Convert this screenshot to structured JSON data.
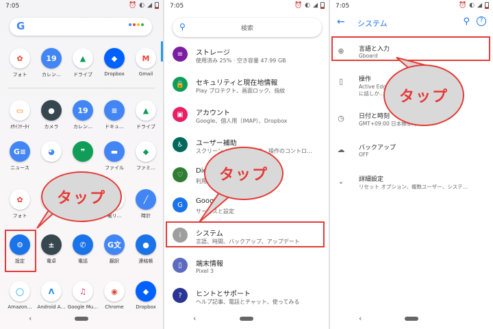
{
  "status": {
    "time": "7:05"
  },
  "home": {
    "google_letter": "G",
    "apps": [
      {
        "label": "フォト",
        "color": "#ffffff",
        "glyph": "✿",
        "fg": "#ea4335"
      },
      {
        "label": "カレン…",
        "color": "#4285f4",
        "glyph": "19",
        "fg": "#fff"
      },
      {
        "label": "ドライブ",
        "color": "#ffffff",
        "glyph": "▲",
        "fg": "#0f9d58"
      },
      {
        "label": "Dropbox",
        "color": "#0061ff",
        "glyph": "◆",
        "fg": "#fff"
      },
      {
        "label": "Gmail",
        "color": "#ffffff",
        "glyph": "M",
        "fg": "#ea4335"
      },
      {
        "label": "ｵｻｲﾌｹｰﾀｲ",
        "color": "#ffffff",
        "glyph": "▭",
        "fg": "#f57c00"
      },
      {
        "label": "カメラ",
        "color": "#37474f",
        "glyph": "●",
        "fg": "#fff"
      },
      {
        "label": "カレン…",
        "color": "#4285f4",
        "glyph": "19",
        "fg": "#fff"
      },
      {
        "label": "ドキュ…",
        "color": "#4285f4",
        "glyph": "≡",
        "fg": "#fff"
      },
      {
        "label": "ドライブ",
        "color": "#ffffff",
        "glyph": "▲",
        "fg": "#0f9d58"
      },
      {
        "label": "ニュース",
        "color": "#4285f4",
        "glyph": "G≡",
        "fg": "#fff"
      },
      {
        "label": "",
        "color": "#ffffff",
        "glyph": "◕",
        "fg": "#4285f4"
      },
      {
        "label": "",
        "color": "#0f9d58",
        "glyph": "❞",
        "fg": "#fff"
      },
      {
        "label": "ファイル",
        "color": "#4285f4",
        "glyph": "▬",
        "fg": "#fff"
      },
      {
        "label": "ファミ…",
        "color": "#ffffff",
        "glyph": "◆",
        "fg": "#0f9d58"
      },
      {
        "label": "フォト",
        "color": "#ffffff",
        "glyph": "✿",
        "fg": "#ea4335"
      },
      {
        "label": "",
        "color": "#ffffff",
        "glyph": "",
        "fg": "#fff"
      },
      {
        "label": "",
        "color": "#ffffff",
        "glyph": "",
        "fg": "#fff"
      },
      {
        "label": "電リ…",
        "color": "#ffffff",
        "glyph": "",
        "fg": "#fff"
      },
      {
        "label": "時計",
        "color": "#4285f4",
        "glyph": "╱",
        "fg": "#fff"
      },
      {
        "label": "設定",
        "color": "#1a73e8",
        "glyph": "⚙",
        "fg": "#fff"
      },
      {
        "label": "電卓",
        "color": "#37474f",
        "glyph": "±",
        "fg": "#fff"
      },
      {
        "label": "電話",
        "color": "#1a73e8",
        "glyph": "✆",
        "fg": "#fff"
      },
      {
        "label": "翻訳",
        "color": "#4285f4",
        "glyph": "G文",
        "fg": "#fff"
      },
      {
        "label": "連絡帳",
        "color": "#1a73e8",
        "glyph": "●",
        "fg": "#fff"
      },
      {
        "label": "Amazon…",
        "color": "#ffffff",
        "glyph": "◯",
        "fg": "#00a8e1"
      },
      {
        "label": "Android A…",
        "color": "#ffffff",
        "glyph": "Λ",
        "fg": "#1e88e5"
      },
      {
        "label": "Google Mu…",
        "color": "#ffffff",
        "glyph": "♫",
        "fg": "#e91e63"
      },
      {
        "label": "Chrome",
        "color": "#ffffff",
        "glyph": "◉",
        "fg": "#db4437"
      },
      {
        "label": "Dropbox",
        "color": "#0061ff",
        "glyph": "◆",
        "fg": "#fff"
      }
    ]
  },
  "callouts": {
    "tap": "タップ"
  },
  "settings": {
    "search_placeholder": "検索",
    "rows": [
      {
        "title": "ストレージ",
        "sub": "使用済み 25% · 空き容量 47.99 GB",
        "color": "#7b1fa2",
        "glyph": "≡"
      },
      {
        "title": "セキュリティと現在地情報",
        "sub": "Play プロテクト、画面ロック、指紋",
        "color": "#0f9d58",
        "glyph": "🔒"
      },
      {
        "title": "アカウント",
        "sub": "Google、個人用（IMAP）、Dropbox",
        "color": "#e91e63",
        "glyph": "▣"
      },
      {
        "title": "ユーザー補助",
        "sub": "スクリーン リーダー、表示、操作のコントロ…",
        "color": "#00695c",
        "glyph": "♿"
      },
      {
        "title": "Digi…",
        "sub": "利用…すみモード",
        "color": "#2e7d32",
        "glyph": "♡"
      },
      {
        "title": "Google",
        "sub": "サービスと設定",
        "color": "#1a73e8",
        "glyph": "G"
      },
      {
        "title": "システム",
        "sub": "言語、時間、バックアップ、アップデート",
        "color": "#9e9e9e",
        "glyph": "i"
      },
      {
        "title": "端末情報",
        "sub": "Pixel 3",
        "color": "#5c6bc0",
        "glyph": "▯"
      },
      {
        "title": "ヒントとサポート",
        "sub": "ヘルプ記事、電話とチャット、使ってみる",
        "color": "#283593",
        "glyph": "?"
      }
    ]
  },
  "system": {
    "title": "システム",
    "rows": [
      {
        "title": "言語と入力",
        "sub": "Gboard",
        "glyph": "⊕"
      },
      {
        "title": "操作",
        "sub": "Active Edg… スタント",
        "sub2": "に話しか…",
        "glyph": "▯"
      },
      {
        "title": "日付と時刻",
        "sub": "GMT+09:00 日本標準時",
        "glyph": "◷"
      },
      {
        "title": "バックアップ",
        "sub": "OFF",
        "glyph": "☁"
      },
      {
        "title": "詳細設定",
        "sub": "リセット オプション、複数ユーザー、システ…",
        "glyph": "⌄"
      }
    ]
  }
}
